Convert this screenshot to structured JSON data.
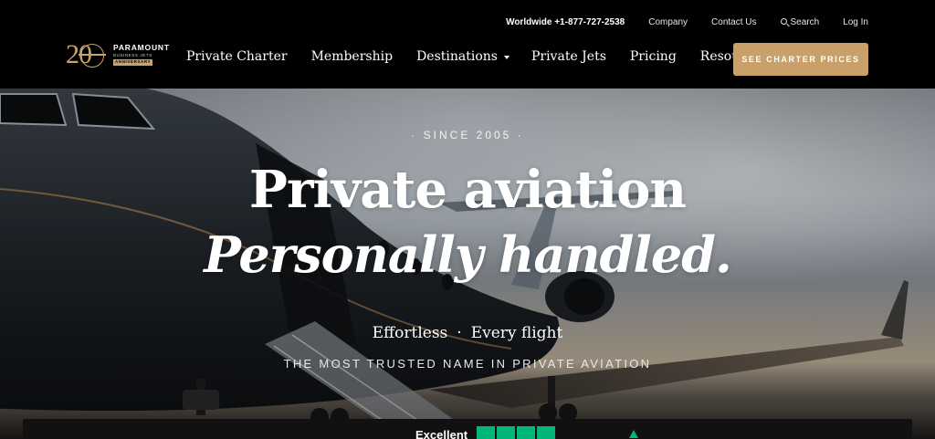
{
  "utility_nav": {
    "phone": "Worldwide +1-877-727-2538",
    "company": "Company",
    "contact": "Contact Us",
    "search": "Search",
    "login": "Log In"
  },
  "logo": {
    "number": "20",
    "line1": "PARAMOUNT",
    "line2": "BUSINESS JETS",
    "line3": "ANNIVERSARY"
  },
  "nav": {
    "items": [
      {
        "label": "Private Charter",
        "dropdown": false
      },
      {
        "label": "Membership",
        "dropdown": false
      },
      {
        "label": "Destinations",
        "dropdown": true
      },
      {
        "label": "Private Jets",
        "dropdown": false
      },
      {
        "label": "Pricing",
        "dropdown": false
      },
      {
        "label": "Resources",
        "dropdown": true
      }
    ],
    "cta_label": "SEE CHARTER PRICES"
  },
  "hero": {
    "since": "· SINCE 2005 ·",
    "title_line1": "Private aviation",
    "title_line2": "Personally handled.",
    "tagline_left": "Effortless",
    "tagline_sep": "·",
    "tagline_right": "Every flight",
    "trusted": "THE MOST TRUSTED NAME IN PRIVATE AVIATION"
  },
  "review_bar": {
    "label": "Excellent"
  },
  "colors": {
    "accent_gold": "#c9a06a",
    "header_bg": "#000000",
    "trustpilot_green": "#00b67a"
  }
}
